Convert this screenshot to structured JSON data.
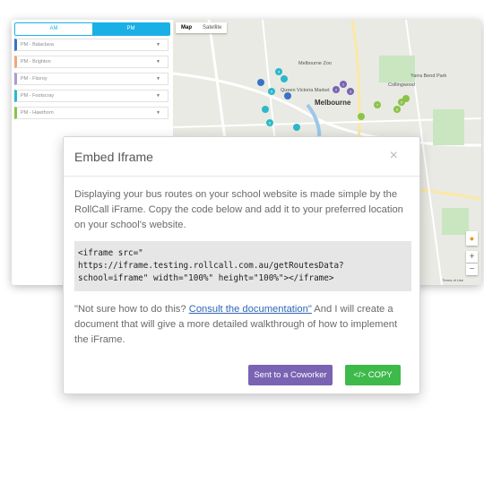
{
  "sidebar": {
    "toggle": {
      "am_label": "AM",
      "pm_label": "PM"
    },
    "routes": [
      {
        "label": "PM - Balaclava",
        "color": "#3a73c4"
      },
      {
        "label": "PM - Brighton",
        "color": "#f0a77a"
      },
      {
        "label": "PM - Fitzroy",
        "color": "#a99bd2"
      },
      {
        "label": "PM - Footscray",
        "color": "#2db8c9"
      },
      {
        "label": "PM - Hawthorn",
        "color": "#8bc34a"
      }
    ]
  },
  "map": {
    "tabs": {
      "map": "Map",
      "satellite": "Satellite"
    },
    "city_label": "Melbourne",
    "labels": [
      "Queen Victoria Market",
      "Melbourne Zoo",
      "Yarra Bend Park",
      "Collingwood"
    ],
    "pin_labels": [
      "1",
      "2",
      "3",
      "4",
      "5",
      "6",
      "7",
      "8",
      "9"
    ],
    "zoom_in": "+",
    "zoom_out": "−",
    "footer_text": "Terms of Use"
  },
  "modal": {
    "title": "Embed Iframe",
    "close_symbol": "×",
    "description": "Displaying your bus routes on your school website is made simple by the RollCall iFrame. Copy the code below and add it to your preferred location on your school's website.",
    "code": "<iframe src=\"\nhttps://iframe.testing.rollcall.com.au/getRoutesData?\nschool=iframe\" width=\"100%\" height=\"100%\"></iframe>",
    "note_prefix": "\"Not sure how to do this? ",
    "note_link": "Consult the documentation\"",
    "note_suffix": " And I will create a document that will give a more detailed walkthrough of how to implement the iFrame.",
    "buttons": {
      "coworker": "Sent to a Coworker",
      "copy": "</> COPY"
    },
    "colors": {
      "coworker": "#7a63b3",
      "copy": "#3eba4a"
    }
  }
}
